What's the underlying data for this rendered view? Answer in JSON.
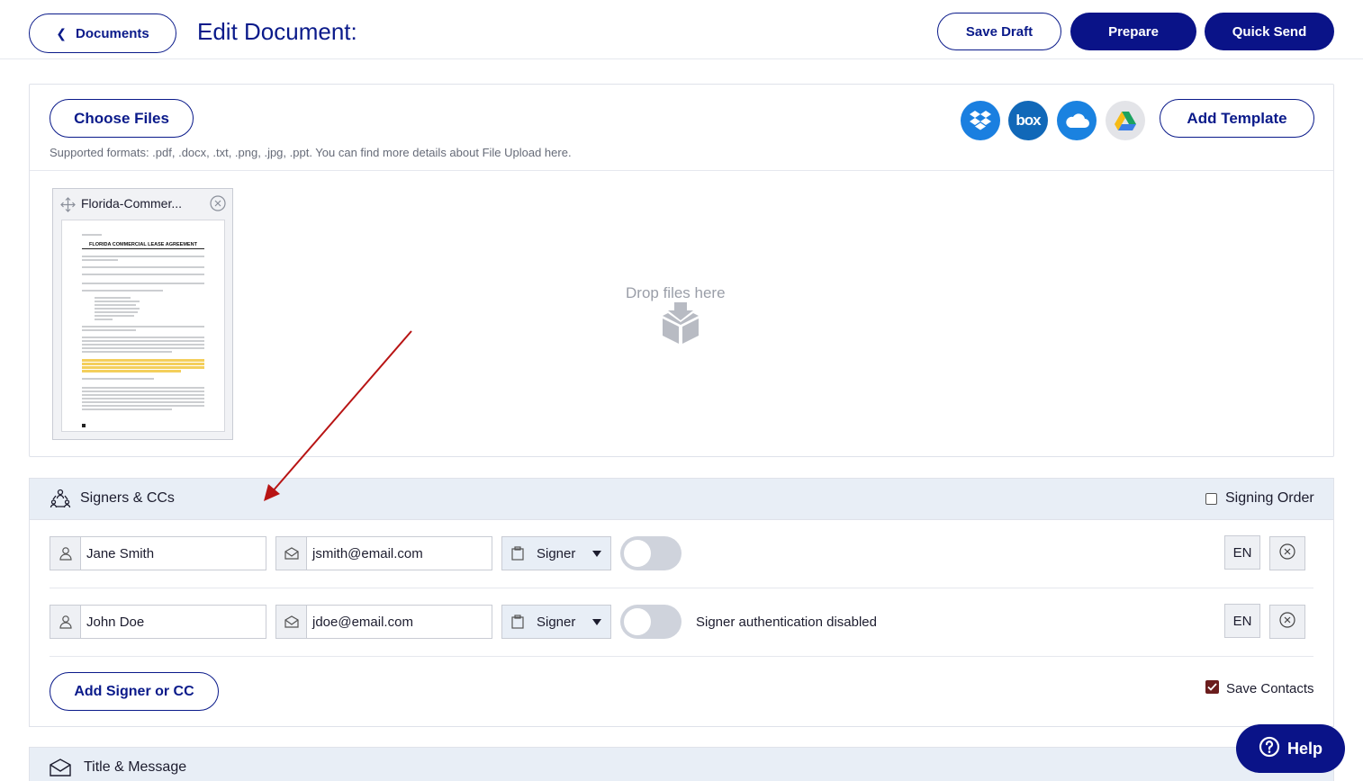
{
  "header": {
    "back_label": "Documents",
    "title": "Edit Document:",
    "save_draft_label": "Save Draft",
    "prepare_label": "Prepare",
    "quick_send_label": "Quick Send"
  },
  "upload": {
    "choose_files_label": "Choose Files",
    "add_template_label": "Add Template",
    "supported_formats": "Supported formats: .pdf, .docx, .txt, .png, .jpg, .ppt. You can find more details about File Upload here.",
    "cloud_sources": [
      "dropbox-icon",
      "box-icon",
      "onedrive-icon",
      "google-drive-icon"
    ],
    "drop_text": "Drop files here",
    "document": {
      "name": "Florida-Commer...",
      "page_heading": "FLORIDA COMMERCIAL LEASE AGREEMENT"
    }
  },
  "signers": {
    "section_title": "Signers & CCs",
    "signing_order_label": "Signing Order",
    "signing_order_checked": false,
    "rows": [
      {
        "name": "Jane Smith",
        "email": "jsmith@email.com",
        "role": "Signer",
        "auth_text": "",
        "lang": "EN"
      },
      {
        "name": "John Doe",
        "email": "jdoe@email.com",
        "role": "Signer",
        "auth_text": "Signer authentication disabled",
        "lang": "EN"
      }
    ],
    "add_label": "Add Signer or CC",
    "save_contacts_label": "Save Contacts",
    "save_contacts_checked": true
  },
  "title_message": {
    "section_title": "Title & Message"
  },
  "help_label": "Help",
  "colors": {
    "brand": "#0a1388",
    "section_bg": "#e8eef6",
    "annotation_arrow": "#b81414"
  }
}
